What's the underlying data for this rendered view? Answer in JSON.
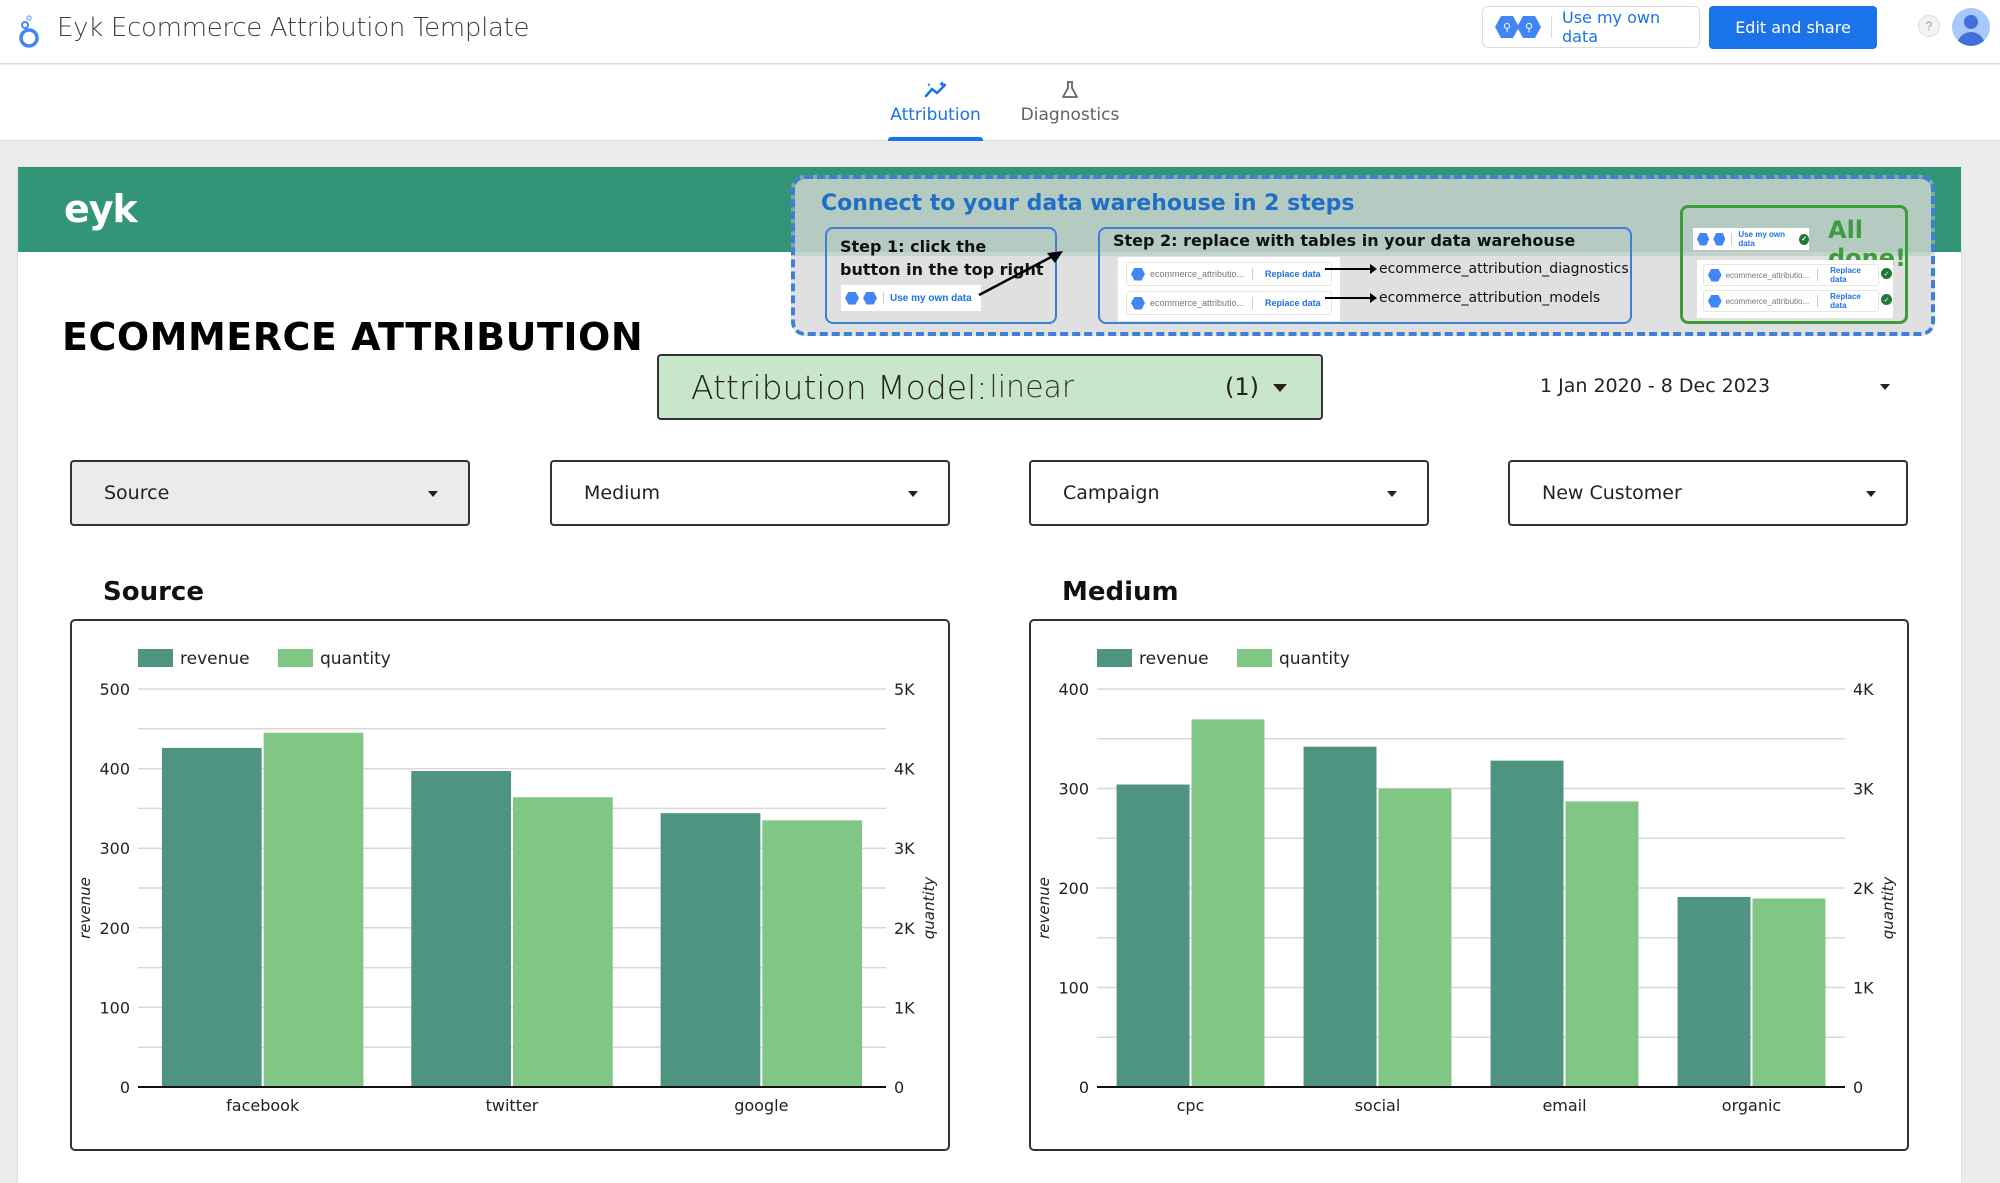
{
  "app": {
    "title": "Eyk Ecommerce Attribution Template",
    "logo_icon": "looker-studio-icon",
    "use_own_data_label": "Use my own data",
    "edit_share_label": "Edit and share",
    "help_label": "?"
  },
  "tabs": [
    {
      "label": "Attribution",
      "icon": "sparkline-icon",
      "active": true
    },
    {
      "label": "Diagnostics",
      "icon": "flask-icon",
      "active": false
    }
  ],
  "report": {
    "brand": "eyk",
    "title": "ECOMMERCE ATTRIBUTION",
    "brand_color": "#339577",
    "onboarding": {
      "title": "Connect to your data warehouse in 2 steps",
      "step1": "Step 1: click the button in the top right",
      "step1_button": "Use my own data",
      "step2": "Step 2: replace with tables in your data warehouse",
      "table_placeholder": "ecommerce_attributio...",
      "replace_label": "Replace data",
      "targets": [
        "ecommerce_attribution_diagnostics",
        "ecommerce_attribution_models"
      ],
      "done_title": "All done!",
      "done_button": "Use my own data"
    },
    "model_control": {
      "label": "Attribution Model",
      "separator": ":",
      "value": "linear",
      "count": "(1)"
    },
    "date_range": "1 Jan 2020 - 8 Dec 2023",
    "filters": [
      {
        "label": "Source"
      },
      {
        "label": "Medium"
      },
      {
        "label": "Campaign"
      },
      {
        "label": "New Customer"
      }
    ]
  },
  "chart_data": [
    {
      "type": "bar",
      "title": "Source",
      "categories": [
        "facebook",
        "twitter",
        "google"
      ],
      "series": [
        {
          "name": "revenue",
          "axis": "left",
          "color": "#4f9480",
          "values": [
            426,
            397,
            344
          ]
        },
        {
          "name": "quantity",
          "axis": "right",
          "color": "#80c684",
          "values": [
            4450,
            3640,
            3350
          ]
        }
      ],
      "xlabel": "",
      "ylabel": "revenue",
      "y2label": "quantity",
      "ylim": [
        0,
        500
      ],
      "y2lim": [
        0,
        5000
      ],
      "yticks": [
        "0",
        "100",
        "200",
        "300",
        "400",
        "500"
      ],
      "y2ticks": [
        "0",
        "1K",
        "2K",
        "3K",
        "4K",
        "5K"
      ],
      "grid": true,
      "legend": "top-left"
    },
    {
      "type": "bar",
      "title": "Medium",
      "categories": [
        "cpc",
        "social",
        "email",
        "organic"
      ],
      "series": [
        {
          "name": "revenue",
          "axis": "left",
          "color": "#4f9480",
          "values": [
            304,
            342,
            328,
            191
          ]
        },
        {
          "name": "quantity",
          "axis": "right",
          "color": "#80c684",
          "values": [
            3695,
            3000,
            2870,
            1895
          ]
        }
      ],
      "xlabel": "",
      "ylabel": "revenue",
      "y2label": "quantity",
      "ylim": [
        0,
        400
      ],
      "y2lim": [
        0,
        4000
      ],
      "yticks": [
        "0",
        "100",
        "200",
        "300",
        "400"
      ],
      "y2ticks": [
        "0",
        "1K",
        "2K",
        "3K",
        "4K"
      ],
      "grid": true,
      "legend": "top-left"
    }
  ]
}
